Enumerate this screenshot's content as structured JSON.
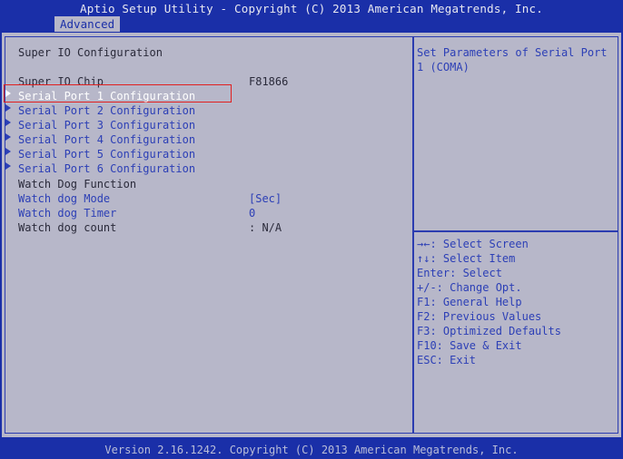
{
  "header": {
    "title": "Aptio Setup Utility - Copyright (C) 2013 American Megatrends, Inc.",
    "active_tab": "Advanced"
  },
  "page": {
    "heading": "Super IO Configuration",
    "chip": {
      "label": "Super IO Chip",
      "value": "F81866"
    },
    "items": [
      {
        "label": "Serial Port 1 Configuration",
        "selected": true
      },
      {
        "label": "Serial Port 2 Configuration"
      },
      {
        "label": "Serial Port 3 Configuration"
      },
      {
        "label": "Serial Port 4 Configuration"
      },
      {
        "label": "Serial Port 5 Configuration"
      },
      {
        "label": "Serial Port 6 Configuration"
      }
    ],
    "watchdog_function": "Watch Dog Function",
    "watchdog_mode": {
      "label": "Watch dog Mode",
      "value": "[Sec]"
    },
    "watchdog_timer": {
      "label": "Watch dog Timer",
      "value": "0"
    },
    "watchdog_count": {
      "label": "Watch dog count",
      "value": ": N/A"
    }
  },
  "help": {
    "description_line1": "Set Parameters of Serial Port",
    "description_line2": "1 (COMA)",
    "keys": [
      "→←: Select Screen",
      "↑↓: Select Item",
      "Enter: Select",
      "+/-: Change Opt.",
      "F1: General Help",
      "F2: Previous Values",
      "F3: Optimized Defaults",
      "F10: Save & Exit",
      "ESC: Exit"
    ]
  },
  "footer": {
    "text": "Version 2.16.1242. Copyright (C) 2013 American Megatrends, Inc."
  },
  "colors": {
    "background": "#1a2fa8",
    "panel": "#b7b7c9",
    "accent_text": "#2c3fb6",
    "selection_border": "#e02020"
  }
}
